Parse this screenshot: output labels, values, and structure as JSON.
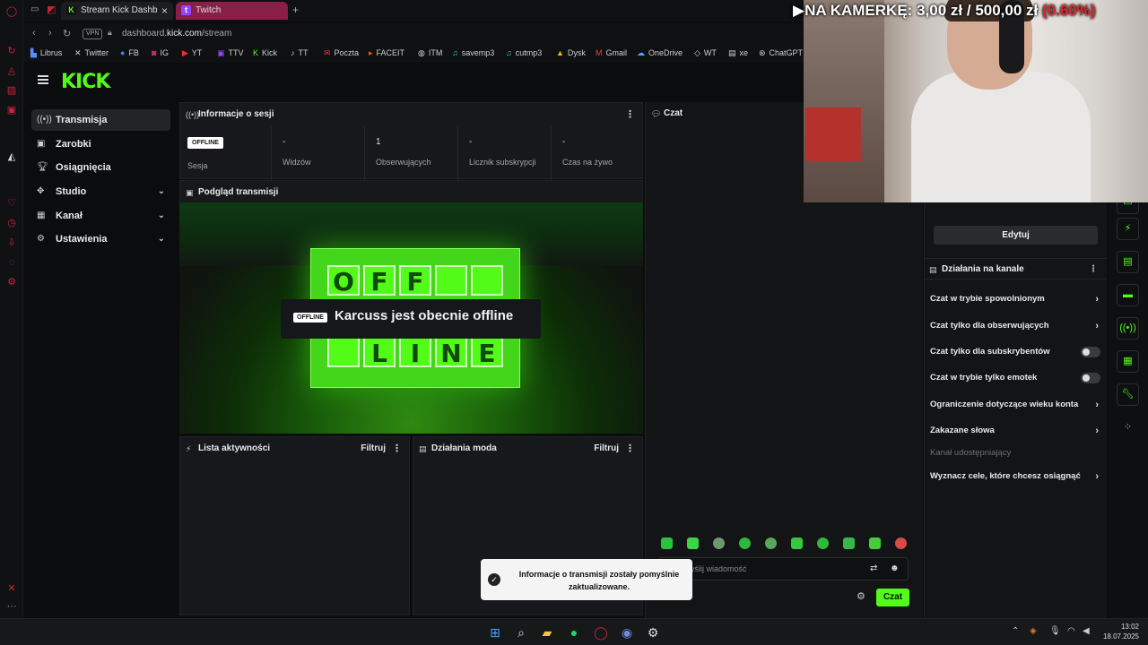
{
  "browser": {
    "tabs": [
      {
        "label": "Stream Kick Dashb",
        "favicon": "kick-icon",
        "active": true
      },
      {
        "label": "Twitch",
        "favicon": "twitch-icon",
        "active": false
      }
    ],
    "vpn_label": "VPN",
    "url_prefix": "dashboard.",
    "url_domain": "kick.com",
    "url_path": "/stream",
    "bookmarks": [
      "Librus",
      "Twitter",
      "FB",
      "IG",
      "YT",
      "TTV",
      "Kick",
      "TT",
      "Poczta",
      "FACEIT",
      "ITM",
      "savemp3",
      "cutmp3",
      "Dysk",
      "Gmail",
      "OneDrive",
      "WT",
      "xe",
      "ChatGPT"
    ]
  },
  "nav": {
    "items": [
      {
        "label": "Transmisja",
        "icon": "broadcast-icon",
        "active": true,
        "has_chevron": false
      },
      {
        "label": "Zarobki",
        "icon": "wallet-icon",
        "active": false,
        "has_chevron": false
      },
      {
        "label": "Osiągnięcia",
        "icon": "trophy-icon",
        "active": false,
        "has_chevron": false
      },
      {
        "label": "Studio",
        "icon": "studio-icon",
        "active": false,
        "has_chevron": true
      },
      {
        "label": "Kanał",
        "icon": "channel-icon",
        "active": false,
        "has_chevron": true
      },
      {
        "label": "Ustawienia",
        "icon": "gear-icon",
        "active": false,
        "has_chevron": true
      }
    ]
  },
  "session": {
    "title": "Informacje o sesji",
    "status_badge": "OFFLINE",
    "stats": [
      {
        "label": "Sesja",
        "value": ""
      },
      {
        "label": "Widzów",
        "value": "-"
      },
      {
        "label": "Obserwujących",
        "value": "1"
      },
      {
        "label": "Licznik subskrypcji",
        "value": "-"
      },
      {
        "label": "Czas na żywo",
        "value": "-"
      }
    ]
  },
  "preview": {
    "title": "Podgląd transmisji",
    "sign_top": [
      "O",
      "F",
      "F",
      ""
    ],
    "sign_bottom": [
      "",
      "L",
      "I",
      "N",
      "E"
    ],
    "offline_badge": "OFFLINE",
    "offline_text": "Karcuss jest obecnie offline"
  },
  "activity": {
    "title": "Lista aktywności",
    "filter": "Filtruj"
  },
  "mod": {
    "title": "Działania moda",
    "filter": "Filtruj"
  },
  "chat": {
    "title": "Czat",
    "input_placeholder": "yślij wiadomość",
    "send_label": "Czat"
  },
  "toast": {
    "text": "Informacje o transmisji zostały pomyślnie zaktualizowane."
  },
  "right_panel": {
    "edit_label": "Edytuj",
    "section_title": "Działania na kanale",
    "items": [
      {
        "label": "Czat w trybie spowolnionym",
        "control": "chevron"
      },
      {
        "label": "Czat tylko dla obserwujących",
        "control": "chevron"
      },
      {
        "label": "Czat tylko dla subskrybentów",
        "control": "toggle"
      },
      {
        "label": "Czat w trybie tylko emotek",
        "control": "toggle"
      },
      {
        "label": "Ograniczenie dotyczące wieku konta",
        "control": "chevron"
      },
      {
        "label": "Zakazane słowa",
        "control": "chevron"
      },
      {
        "label": "Kanał udostępniający",
        "control": "none"
      },
      {
        "label": "Wyznacz cele, które chcesz osiągnąć",
        "control": "chevron"
      }
    ]
  },
  "webcam_overlay": {
    "prefix": "▶NA KAMERKĘ:",
    "current": "3,00 zł",
    "separator": "/",
    "goal": "500,00 zł",
    "percent": "(0.60%)"
  },
  "taskbar": {
    "time": "13:02",
    "date": "18.07.2025"
  },
  "colors": {
    "accent": "#53fc18",
    "opera_red": "#c8243c",
    "goal_red": "#e3262a"
  }
}
